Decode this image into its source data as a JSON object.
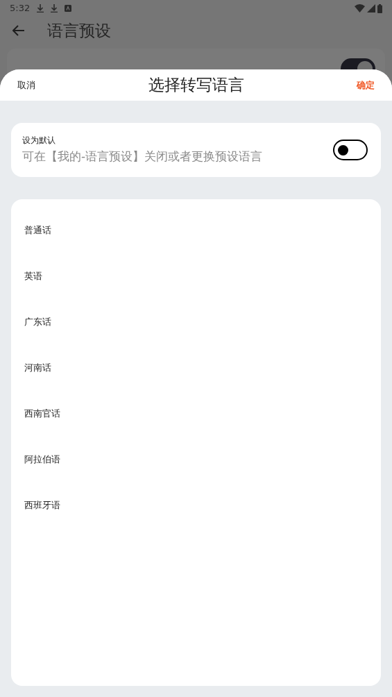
{
  "status_bar": {
    "time": "5:32"
  },
  "background_page": {
    "title": "语言预设",
    "setting": {
      "on": true
    }
  },
  "sheet": {
    "cancel": "取消",
    "title": "选择转写语言",
    "confirm": "确定",
    "default_card": {
      "label": "设为默认",
      "hint": "可在【我的-语言预设】关闭或者更换预设语言",
      "on": false
    },
    "languages": [
      {
        "label": "普通话"
      },
      {
        "label": "英语"
      },
      {
        "label": "广东话"
      },
      {
        "label": "河南话"
      },
      {
        "label": "西南官话"
      },
      {
        "label": "阿拉伯语"
      },
      {
        "label": "西班牙语"
      }
    ]
  }
}
